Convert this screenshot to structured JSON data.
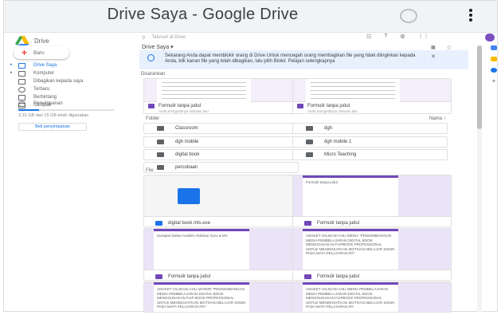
{
  "window": {
    "title": "Drive Saya - Google Drive"
  },
  "sidebar": {
    "brand": "Drive",
    "new_label": "Baru",
    "items": [
      {
        "label": "Drive Saya",
        "selected": true
      },
      {
        "label": "Komputer",
        "selected": false
      },
      {
        "label": "Dibagikan kepada saya",
        "selected": false
      },
      {
        "label": "Terbaru",
        "selected": false
      },
      {
        "label": "Berbintang",
        "selected": false
      },
      {
        "label": "Sampah",
        "selected": false
      }
    ],
    "storage_label": "Penyimpanan",
    "storage_text": "3,31 GB dari 15 GB telah digunakan",
    "storage_used_fraction": 0.22,
    "buy_label": "Beli penyimpanan"
  },
  "header": {
    "search_placeholder": "Telusuri di Drive",
    "breadcrumb": "Drive Saya ▾"
  },
  "banner": {
    "text": "Sekarang Anda dapat memblokir orang di Drive Untuk mencegah orang membagikan file yang tidak diinginkan kepada Anda, klik kanan file yang telah dibagikan, lalu pilih Blokir. Pelajari selengkapnya"
  },
  "suggested": {
    "heading": "Disarankan",
    "cards": [
      {
        "name": "Formulir tanpa judul",
        "sub": "Anda mengeditnya sebulan lalu"
      },
      {
        "name": "Formulir tanpa judul",
        "sub": "Anda mengeditnya sebulan lalu"
      }
    ]
  },
  "folders": {
    "heading": "Folder",
    "sort_label": "Nama ↑",
    "items": [
      "Classroom",
      "dgh",
      "dgh mobile",
      "dgh mobile 1",
      "digital book",
      "Micro Teaching",
      "percobaan"
    ]
  },
  "files": {
    "heading": "File",
    "items": [
      {
        "name": "digital book mts.exe",
        "kind": "exe"
      },
      {
        "name": "Formulir tanpa judul",
        "kind": "form",
        "preview": "Formulir tanpa judul"
      },
      {
        "name": "Formulir tanpa judul",
        "kind": "form",
        "preview": "Harapan bahan Analisis Aktivitas Guru & MA"
      },
      {
        "name": "Formulir tanpa judul",
        "kind": "form",
        "preview": "ANGKET VALIDASI AHLI MEDIA \"PENGEMBANGAN MEDIA PEMBELAJARAN DIGITAL BOOK MENGGUNAKAN FLIPBOOK PROFESSIONAL UNTUK MENINGKATKAN MOTIVASI BELAJAR SISWA PADA MATA PELAJARAN IPA\""
      },
      {
        "name": "",
        "kind": "form",
        "preview": "ANGKET VALIDASI AHLI MATERI \"PENGEMBANGAN MEDIA PEMBELAJARAN DIGITAL BOOK MENGGUNAKAN FLIP BOOK PROFESSIONAL UNTUK MENINGKATKAN MOTIVASI BELAJAR SISWA PADA MATA PELAJARAN IPA\""
      },
      {
        "name": "",
        "kind": "form",
        "preview": "ANGKET VALIDASI AHLI MEDIA PEMBELAJARAN MEDIA PEMBELAJARAN DIGITAL BOOK MENGGUNAKAN FLIPBOOK PROFESSIONAL UNTUK MENINGKATKAN MOTIVASI BELAJAR SISWA PADA MATA PELAJARAN IPA"
      }
    ]
  },
  "colors": {
    "accent": "#1a73e8",
    "form": "#7248b9",
    "banner": "#e8f0fe"
  }
}
